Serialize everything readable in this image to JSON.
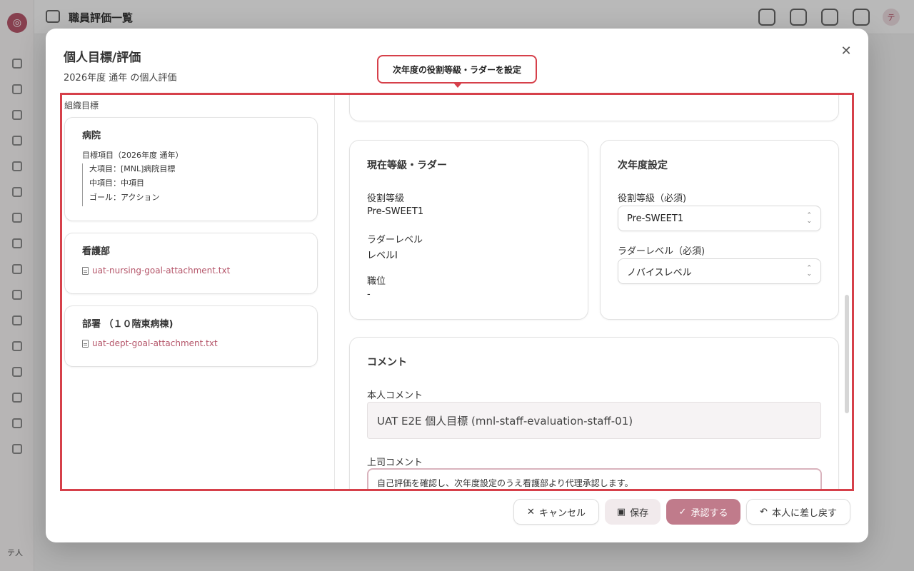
{
  "background": {
    "page_title": "職員評価一覧",
    "logo_glyph": "◎",
    "user_initials": "テ人",
    "avatar_initial": "テ"
  },
  "modal": {
    "title": "個人目標/評価",
    "subtitle": "2026年度 通年 の個人評価",
    "close_glyph": "✕"
  },
  "tooltip": {
    "text": "次年度の役割等級・ラダーを設定"
  },
  "org_goals": {
    "label": "組織目標",
    "hospital": {
      "title": "病院",
      "goal_header": "目標項目（2026年度 通年）",
      "items": [
        "大項目：[MNL]病院目標",
        "中項目：中項目",
        "ゴール：アクション"
      ]
    },
    "nursing": {
      "title": "看護部",
      "attachment": "uat-nursing-goal-attachment.txt"
    },
    "department": {
      "title": "部署 （１０階東病棟)",
      "attachment": "uat-dept-goal-attachment.txt"
    }
  },
  "current_grade": {
    "title": "現在等級・ラダー",
    "role_grade_label": "役割等級",
    "role_grade_value": "Pre-SWEET1",
    "ladder_label": "ラダーレベル",
    "ladder_value": "レベルⅠ",
    "position_label": "職位",
    "position_value": "-"
  },
  "next_year": {
    "title": "次年度設定",
    "role_grade_label": "役割等級（必須)",
    "role_grade_selected": "Pre-SWEET1",
    "ladder_label": "ラダーレベル（必須)",
    "ladder_selected": "ノバイスレベル"
  },
  "comments": {
    "title": "コメント",
    "self_label": "本人コメント",
    "self_value": "UAT E2E 個人目標 (mnl-staff-evaluation-staff-01)",
    "supervisor_label": "上司コメント",
    "supervisor_value": "自己評価を確認し、次年度設定のうえ看護部より代理承認します。"
  },
  "footer": {
    "cancel_label": "キャンセル",
    "save_label": "保存",
    "approve_label": "承認する",
    "return_label": "本人に差し戻す",
    "cancel_icon": "✕",
    "save_icon": "▣",
    "approve_icon": "✓",
    "return_icon": "↶"
  },
  "colors": {
    "accent": "#b5566a",
    "highlight_border": "#d6404a",
    "approve_button": "#c07b8b"
  }
}
